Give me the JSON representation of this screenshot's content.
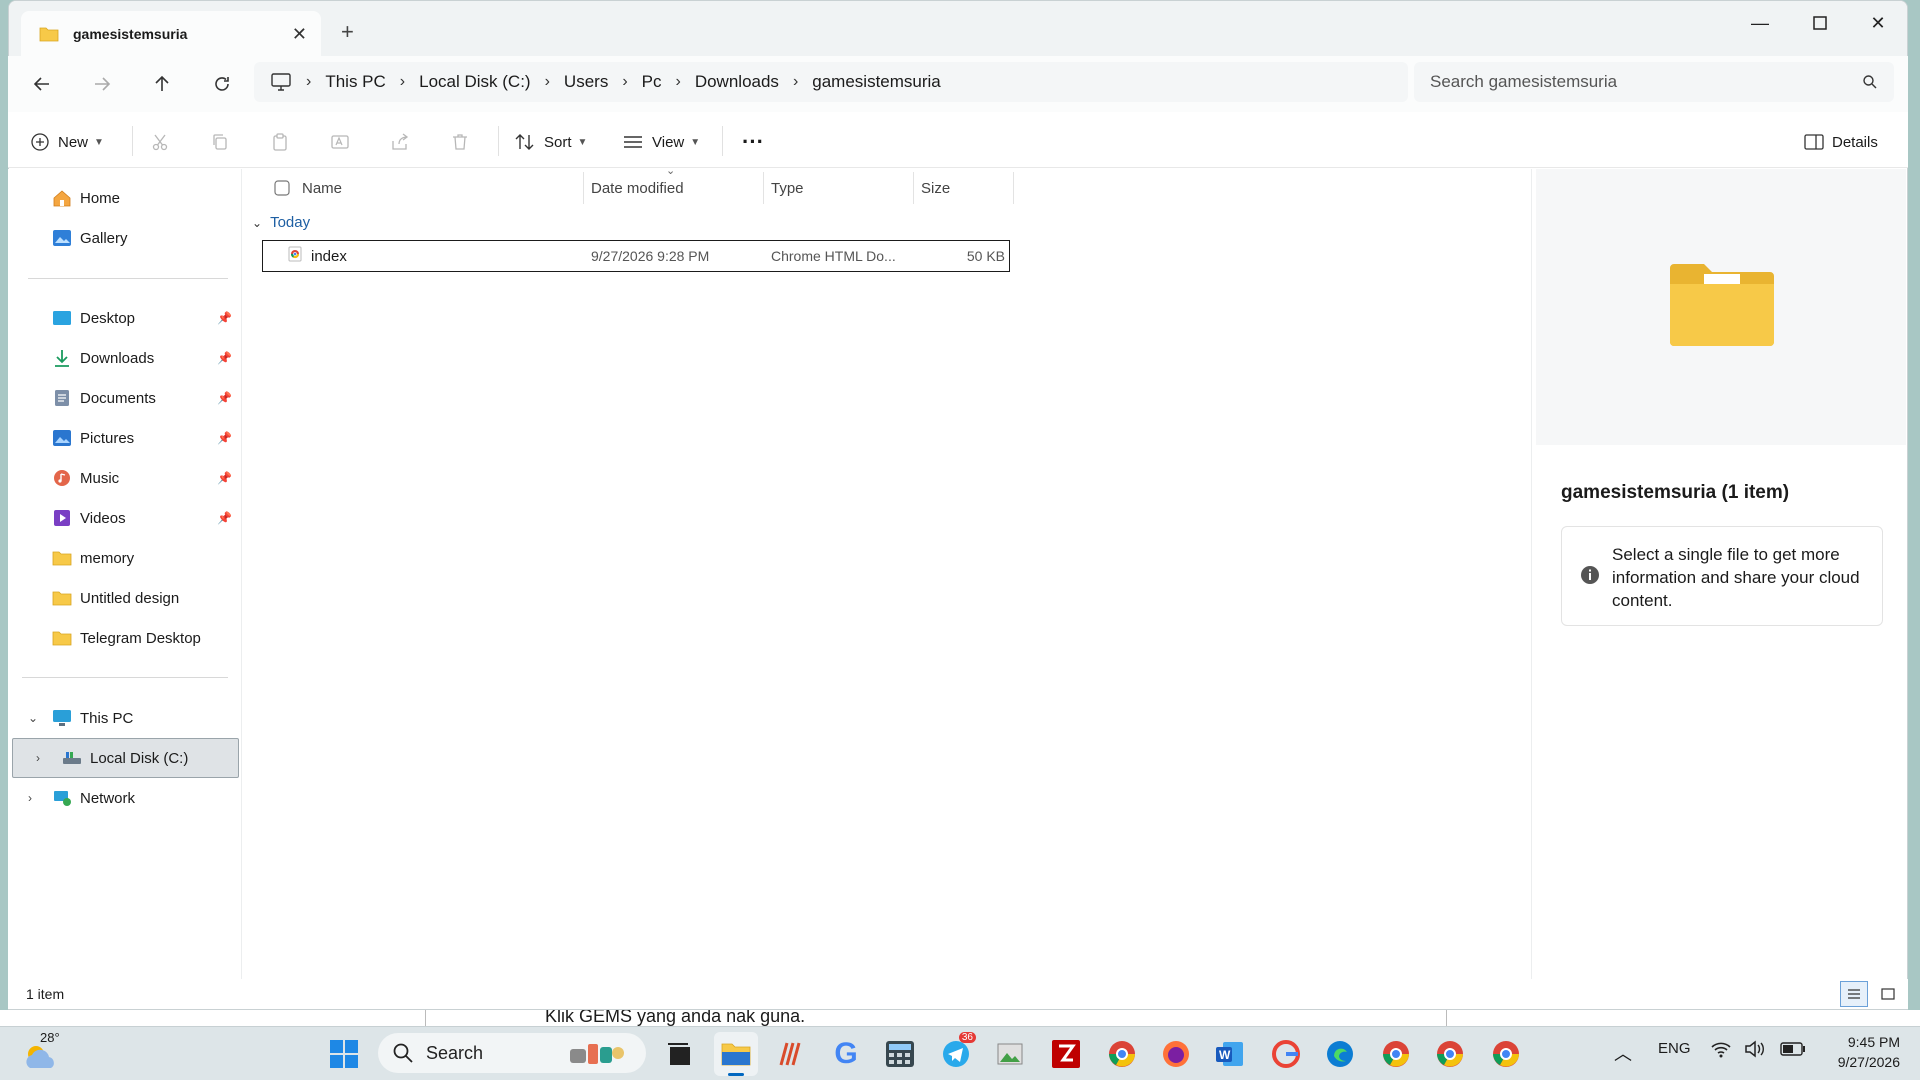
{
  "window": {
    "tab_title": "gamesistemsuria"
  },
  "address": {
    "crumbs": [
      "This PC",
      "Local Disk (C:)",
      "Users",
      "Pc",
      "Downloads",
      "gamesistemsuria"
    ]
  },
  "search": {
    "placeholder": "Search gamesistemsuria"
  },
  "toolbar": {
    "new_label": "New",
    "sort_label": "Sort",
    "view_label": "View",
    "details_label": "Details"
  },
  "nav": {
    "home": "Home",
    "gallery": "Gallery",
    "quick": [
      {
        "label": "Desktop",
        "icon": "desktop-icon"
      },
      {
        "label": "Downloads",
        "icon": "downloads-icon"
      },
      {
        "label": "Documents",
        "icon": "documents-icon"
      },
      {
        "label": "Pictures",
        "icon": "pictures-icon"
      },
      {
        "label": "Music",
        "icon": "music-icon"
      },
      {
        "label": "Videos",
        "icon": "videos-icon"
      },
      {
        "label": "memory",
        "icon": "folder-icon"
      },
      {
        "label": "Untitled design",
        "icon": "folder-icon"
      },
      {
        "label": "Telegram Desktop",
        "icon": "folder-icon"
      }
    ],
    "this_pc": "This PC",
    "local_disk": "Local Disk (C:)",
    "network": "Network"
  },
  "columns": {
    "name": "Name",
    "date": "Date modified",
    "type": "Type",
    "size": "Size"
  },
  "group": {
    "label": "Today"
  },
  "files": [
    {
      "name": "index",
      "date": "9/27/2026 9:28 PM",
      "type": "Chrome HTML Do...",
      "size": "50 KB"
    }
  ],
  "details": {
    "title": "gamesistemsuria (1 item)",
    "info": "Select a single file to get more information and share your cloud content."
  },
  "status": {
    "count": "1 item"
  },
  "underlay": {
    "text": "Klik GEMS yang anda nak guna."
  },
  "taskbar": {
    "weather": "28°",
    "search_label": "Search",
    "telegram_badge": "36",
    "lang": "ENG",
    "time": "9:45 PM",
    "date": "9/27/2026"
  },
  "colors": {
    "accent": "#0067c0",
    "folder": "#f7c948",
    "group_blue": "#1e5fa3"
  }
}
